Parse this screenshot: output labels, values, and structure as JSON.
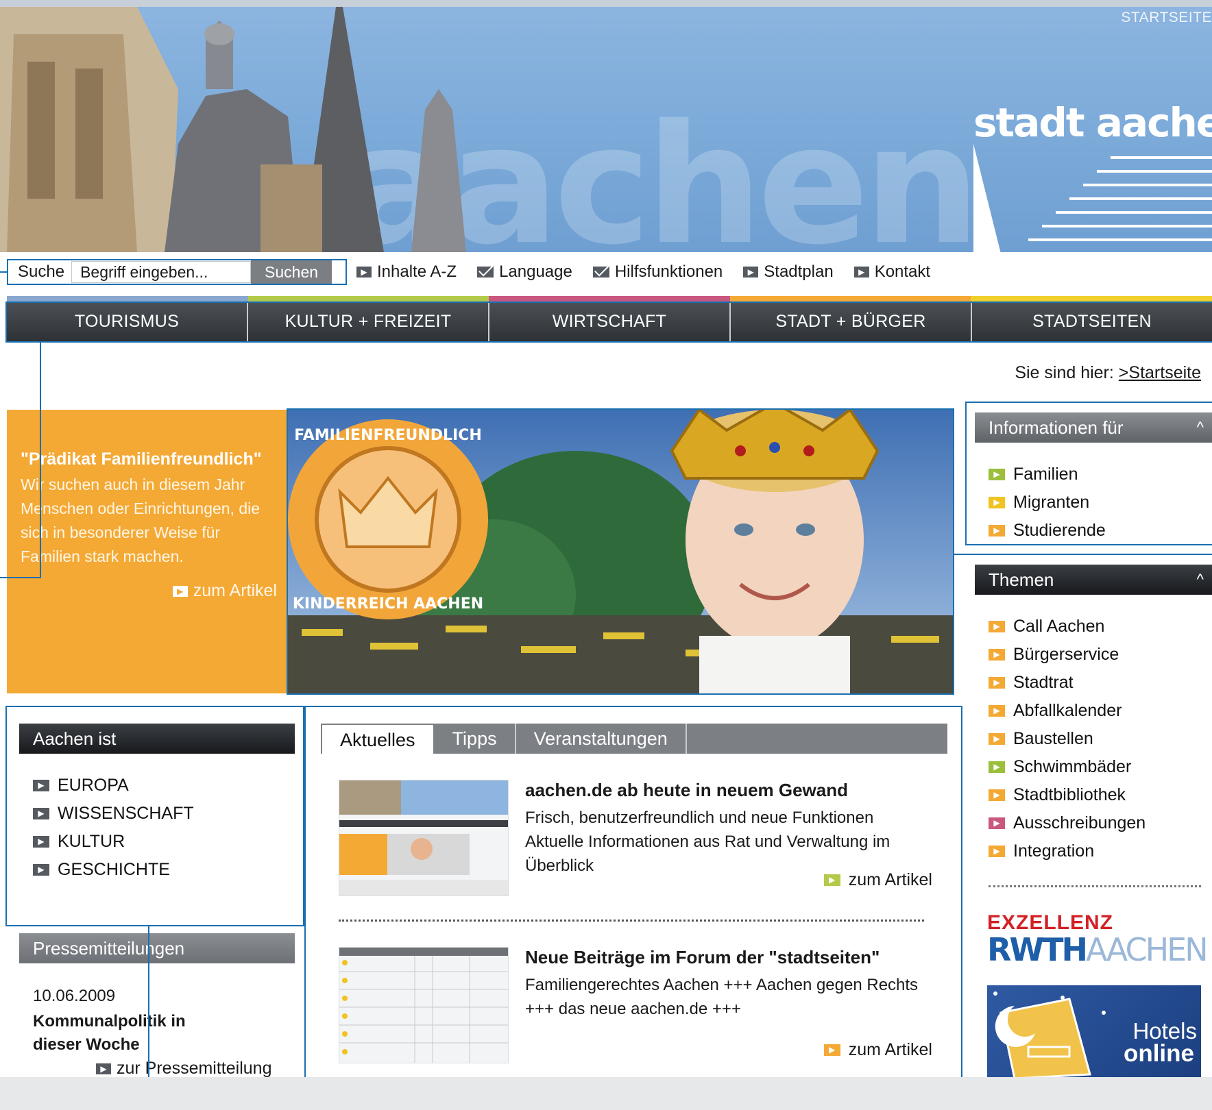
{
  "header": {
    "startseite_label": "STARTSEITE",
    "logo_text": "stadt aachen",
    "watermark_text": "aachen"
  },
  "search": {
    "label": "Suche",
    "value": "Begriff eingeben...",
    "button_label": "Suchen"
  },
  "meta_links": [
    {
      "label": "Inhalte A-Z",
      "icon": "arrow-icon"
    },
    {
      "label": "Language",
      "icon": "mail-icon"
    },
    {
      "label": "Hilfsfunktionen",
      "icon": "mail-icon"
    },
    {
      "label": "Stadtplan",
      "icon": "arrow-icon"
    },
    {
      "label": "Kontakt",
      "icon": "arrow-icon"
    }
  ],
  "nav": {
    "items": [
      "TOURISMUS",
      "KULTUR + FREIZEIT",
      "WIRTSCHAFT",
      "STADT + BÜRGER",
      "STADTSEITEN"
    ],
    "stripe_colors": [
      "#8aa8cf",
      "#b3c94a",
      "#c9577f",
      "#f4a935",
      "#f0cf2b"
    ]
  },
  "breadcrumb": {
    "prefix": "Sie sind hier:",
    "link": ">Startseite"
  },
  "teaser": {
    "title": "\"Prädikat Familienfreundlich\"",
    "body": "Wir suchen auch in diesem Jahr Menschen oder Einrichtungen, die sich in besonderer Weise für Familien stark machen.",
    "more": "zum Artikel",
    "color": "#f4a935"
  },
  "hero": {
    "badge_text_top": "FAMILIENFREUNDLICH",
    "badge_text_bottom": "KINDERREICH AACHEN"
  },
  "aachen_ist": {
    "title": "Aachen ist",
    "items": [
      "EUROPA",
      "WISSENSCHAFT",
      "KULTUR",
      "GESCHICHTE"
    ]
  },
  "press": {
    "title": "Pressemitteilungen",
    "date": "10.06.2009",
    "headline": "Kommunalpolitik in dieser Woche",
    "link": "zur Pressemitteilung"
  },
  "tabs": [
    "Aktuelles",
    "Tipps",
    "Veranstaltungen"
  ],
  "news": [
    {
      "title": "aachen.de ab heute in neuem Gewand",
      "body": "Frisch, benutzerfreundlich und neue Funktionen Aktuelle Informationen aus Rat und Verwaltung im Überblick",
      "more": "zum Artikel"
    },
    {
      "title": "Neue Beiträge im Forum der \"stadtseiten\"",
      "body": "Familiengerechtes Aachen +++ Aachen gegen Rechts +++ das neue aachen.de +++",
      "more": "zum Artikel"
    }
  ],
  "info_fuer": {
    "title": "Informationen für",
    "items": [
      {
        "label": "Familien",
        "color": "#9bbf3b"
      },
      {
        "label": "Migranten",
        "color": "#f0c320"
      },
      {
        "label": "Studierende",
        "color": "#f4a935"
      }
    ]
  },
  "themen": {
    "title": "Themen",
    "items": [
      {
        "label": "Call Aachen",
        "color": "#f4a935"
      },
      {
        "label": "Bürgerservice",
        "color": "#f4a935"
      },
      {
        "label": "Stadtrat",
        "color": "#f4a935"
      },
      {
        "label": "Abfallkalender",
        "color": "#f4a935"
      },
      {
        "label": "Baustellen",
        "color": "#f4a935"
      },
      {
        "label": "Schwimmbäder",
        "color": "#9bbf3b"
      },
      {
        "label": "Stadtbibliothek",
        "color": "#f4a935"
      },
      {
        "label": "Ausschreibungen",
        "color": "#c9577f"
      },
      {
        "label": "Integration",
        "color": "#f4a935"
      }
    ]
  },
  "ads": {
    "rwth_line1": "EXZELLENZ",
    "rwth_line2a": "RWTH",
    "rwth_line2b": "AACHEN",
    "hotels_line1": "Hotels",
    "hotels_line2": "online"
  },
  "colors": {
    "accent_outline": "#1a6fb0",
    "nav_dark": "#2e3236",
    "orange": "#f4a935"
  }
}
